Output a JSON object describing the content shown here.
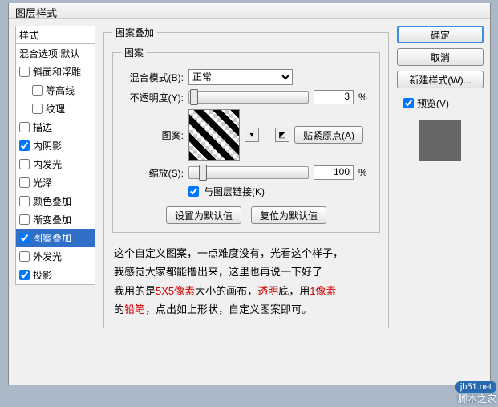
{
  "window": {
    "title": "图层样式"
  },
  "left": {
    "header": "样式",
    "blending": "混合选项:默认",
    "items": [
      {
        "label": "斜面和浮雕",
        "checked": false,
        "indent": false
      },
      {
        "label": "等高线",
        "checked": false,
        "indent": true
      },
      {
        "label": "纹理",
        "checked": false,
        "indent": true
      },
      {
        "label": "描边",
        "checked": false,
        "indent": false
      },
      {
        "label": "内阴影",
        "checked": true,
        "indent": false
      },
      {
        "label": "内发光",
        "checked": false,
        "indent": false
      },
      {
        "label": "光泽",
        "checked": false,
        "indent": false
      },
      {
        "label": "颜色叠加",
        "checked": false,
        "indent": false
      },
      {
        "label": "渐变叠加",
        "checked": false,
        "indent": false
      },
      {
        "label": "图案叠加",
        "checked": true,
        "indent": false,
        "selected": true
      },
      {
        "label": "外发光",
        "checked": false,
        "indent": false
      },
      {
        "label": "投影",
        "checked": true,
        "indent": false
      }
    ]
  },
  "panel": {
    "title": "图案叠加",
    "subtitle": "图案",
    "blend_label": "混合模式(B):",
    "blend_value": "正常",
    "opacity_label": "不透明度(Y):",
    "opacity_value": "3",
    "opacity_unit": "%",
    "pattern_label": "图案:",
    "snap_btn": "贴紧原点(A)",
    "scale_label": "缩放(S):",
    "scale_value": "100",
    "scale_unit": "%",
    "link_label": "与图层链接(K)",
    "make_default": "设置为默认值",
    "reset_default": "复位为默认值"
  },
  "desc": {
    "l1a": "这个自定义图案，一点难度没有，光看这个样子，",
    "l2a": "我感觉大家都能撸出来，这里也再说一下好了",
    "l3a": "我用的是",
    "l3b": "5X5像素",
    "l3c": "大小的画布，",
    "l3d": "透明",
    "l3e": "底，用",
    "l3f": "1像素",
    "l4a": "的",
    "l4b": "铅笔",
    "l4c": "，点出如上形状，自定义图案即可。"
  },
  "right": {
    "ok": "确定",
    "cancel": "取消",
    "newstyle": "新建样式(W)...",
    "preview": "预览(V)"
  },
  "watermark": {
    "domain": "jb51.net",
    "text": "脚本之家"
  }
}
